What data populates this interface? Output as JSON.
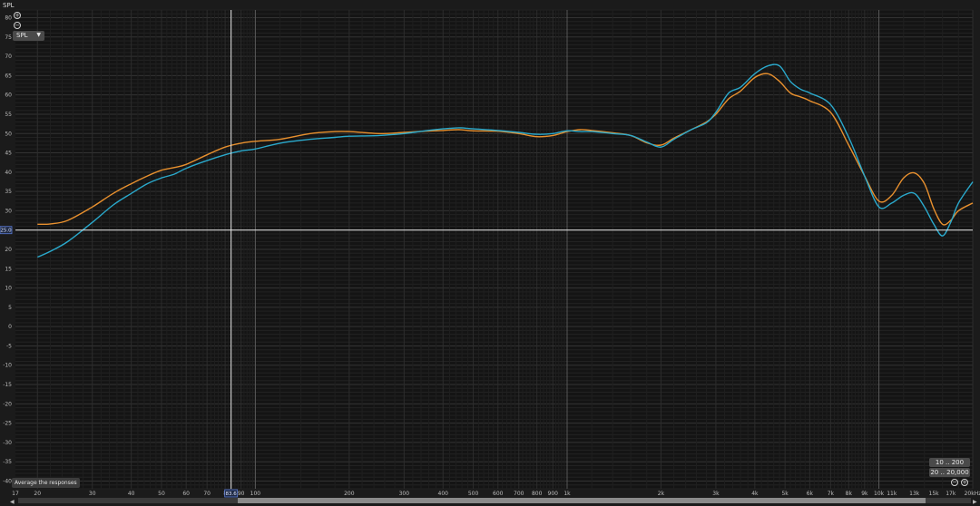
{
  "chart_data": {
    "type": "line",
    "ylabel": "SPL",
    "x_scale": "log",
    "xlim": [
      17,
      20000
    ],
    "ylim": [
      -42,
      82
    ],
    "y_ticks": [
      80,
      75,
      70,
      65,
      60,
      55,
      50,
      45,
      40,
      35,
      30,
      25,
      20,
      15,
      10,
      5,
      0,
      -5,
      -10,
      -15,
      -20,
      -25,
      -30,
      -35,
      -40
    ],
    "x_ticks": [
      {
        "v": 17,
        "label": "17"
      },
      {
        "v": 20,
        "label": "20"
      },
      {
        "v": 30,
        "label": "30"
      },
      {
        "v": 40,
        "label": "40"
      },
      {
        "v": 50,
        "label": "50"
      },
      {
        "v": 60,
        "label": "60"
      },
      {
        "v": 70,
        "label": "70"
      },
      {
        "v": 80,
        "label": "8"
      },
      {
        "v": 90,
        "label": "90"
      },
      {
        "v": 100,
        "label": "100"
      },
      {
        "v": 200,
        "label": "200"
      },
      {
        "v": 300,
        "label": "300"
      },
      {
        "v": 400,
        "label": "400"
      },
      {
        "v": 500,
        "label": "500"
      },
      {
        "v": 600,
        "label": "600"
      },
      {
        "v": 700,
        "label": "700"
      },
      {
        "v": 800,
        "label": "800"
      },
      {
        "v": 900,
        "label": "900"
      },
      {
        "v": 1000,
        "label": "1k"
      },
      {
        "v": 2000,
        "label": "2k"
      },
      {
        "v": 3000,
        "label": "3k"
      },
      {
        "v": 4000,
        "label": "4k"
      },
      {
        "v": 5000,
        "label": "5k"
      },
      {
        "v": 6000,
        "label": "6k"
      },
      {
        "v": 7000,
        "label": "7k"
      },
      {
        "v": 8000,
        "label": "8k"
      },
      {
        "v": 9000,
        "label": "9k"
      },
      {
        "v": 10000,
        "label": "10k"
      },
      {
        "v": 11000,
        "label": "11k"
      },
      {
        "v": 13000,
        "label": "13k"
      },
      {
        "v": 15000,
        "label": "15k"
      },
      {
        "v": 17000,
        "label": "17k"
      },
      {
        "v": 20000,
        "label": "20kHz"
      }
    ],
    "cursor": {
      "x_label": "83.6",
      "y_label": "25.0",
      "x": 83.6,
      "y": 25.0
    },
    "grid": true,
    "series": [
      {
        "color": "#e8902e",
        "x": [
          20,
          22,
          25,
          30,
          35,
          40,
          45,
          50,
          55,
          60,
          70,
          80,
          90,
          100,
          120,
          150,
          180,
          200,
          250,
          300,
          350,
          400,
          450,
          500,
          600,
          700,
          800,
          900,
          1000,
          1100,
          1200,
          1400,
          1600,
          1800,
          2000,
          2200,
          2500,
          2800,
          3000,
          3300,
          3600,
          4000,
          4400,
          4800,
          5200,
          5600,
          6000,
          7000,
          8000,
          9000,
          10000,
          11000,
          12000,
          13000,
          14000,
          15000,
          16000,
          17000,
          18000,
          20000
        ],
        "y": [
          26.5,
          26.6,
          27.5,
          31,
          34.5,
          37,
          39,
          40.5,
          41.2,
          42,
          44.5,
          46.5,
          47.5,
          48,
          48.5,
          50,
          50.5,
          50.5,
          50,
          50.3,
          50.6,
          50.8,
          51,
          50.7,
          50.6,
          50,
          49.2,
          49.5,
          50.5,
          51,
          50.8,
          50.2,
          49.5,
          47.6,
          47,
          48.8,
          51,
          53,
          55,
          59,
          61,
          64.5,
          65.5,
          63.5,
          60.5,
          59.5,
          58.5,
          55.5,
          47,
          39,
          32.5,
          34,
          38.5,
          39.8,
          37,
          30.5,
          26.5,
          27.5,
          30,
          32
        ]
      },
      {
        "color": "#2aa9cc",
        "x": [
          20,
          22,
          25,
          30,
          35,
          40,
          45,
          50,
          55,
          60,
          70,
          80,
          90,
          100,
          120,
          150,
          180,
          200,
          250,
          300,
          350,
          400,
          450,
          500,
          600,
          700,
          800,
          900,
          1000,
          1100,
          1200,
          1400,
          1600,
          1800,
          2000,
          2200,
          2500,
          2800,
          3000,
          3300,
          3600,
          4000,
          4400,
          4800,
          5200,
          5600,
          6000,
          7000,
          8000,
          9000,
          10000,
          11000,
          12000,
          13000,
          14000,
          15000,
          16000,
          17000,
          18000,
          20000
        ],
        "y": [
          18,
          19.5,
          22,
          27,
          31.5,
          34.5,
          37,
          38.5,
          39.5,
          41,
          43,
          44.5,
          45.5,
          46,
          47.5,
          48.5,
          49,
          49.3,
          49.5,
          50,
          50.7,
          51.2,
          51.5,
          51.2,
          50.8,
          50.3,
          49.8,
          50,
          50.7,
          50.5,
          50.5,
          50,
          49.5,
          47.8,
          46.5,
          48.5,
          51,
          52.8,
          55.5,
          60.5,
          62,
          65.5,
          67.5,
          67.5,
          63.5,
          61.5,
          60.5,
          57.5,
          49,
          39,
          31,
          32,
          34,
          34.5,
          31,
          26.5,
          23.5,
          27,
          32,
          37.5
        ]
      }
    ]
  },
  "ui": {
    "spl_title": "SPL",
    "spl_dropdown": "SPL",
    "zoom_in": "+",
    "zoom_out": "−",
    "average_button": "Average the responses",
    "range_button_1": "10 .. 200",
    "range_button_2": "20 .. 20,000",
    "scroll_left": "◀",
    "scroll_right": "▶"
  }
}
